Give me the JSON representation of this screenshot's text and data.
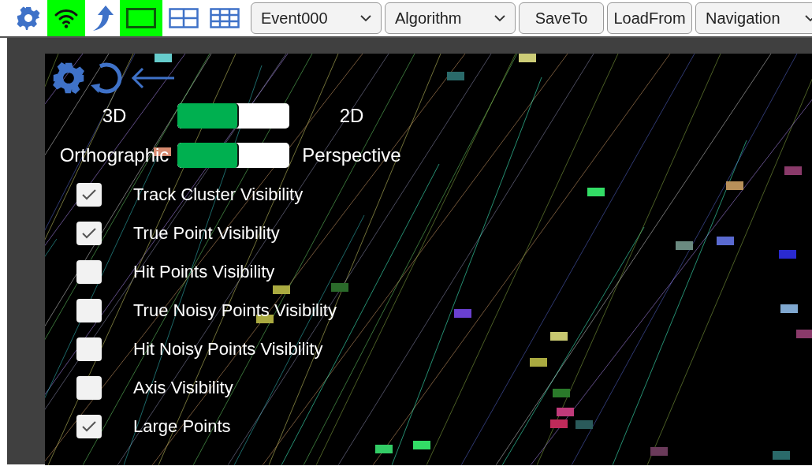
{
  "toolbar": {
    "icons": [
      {
        "kind": "gear",
        "on": false
      },
      {
        "kind": "wifi",
        "on": true
      },
      {
        "kind": "arrow",
        "on": false
      },
      {
        "kind": "single",
        "on": true
      },
      {
        "kind": "grid2",
        "on": false
      },
      {
        "kind": "grid3",
        "on": false
      }
    ],
    "controls": [
      {
        "kind": "dropdown",
        "label": "Event000"
      },
      {
        "kind": "dropdown",
        "label": "Algorithm"
      },
      {
        "kind": "button",
        "label": "SaveTo"
      },
      {
        "kind": "button",
        "label": "LoadFrom"
      },
      {
        "kind": "dropdown",
        "label": "Navigation"
      }
    ]
  },
  "panel": {
    "toggles": [
      {
        "left": "3D",
        "right": "2D",
        "level": 0.55
      },
      {
        "left": "Orthographic",
        "right": "Perspective",
        "level": 0.55
      }
    ],
    "checkboxes": [
      {
        "label": "Track Cluster Visibility",
        "checked": true
      },
      {
        "label": "True Point Visibility",
        "checked": true
      },
      {
        "label": "Hit Points Visibility",
        "checked": false
      },
      {
        "label": "True Noisy Points Visibility",
        "checked": false
      },
      {
        "label": "Hit Noisy Points Visibility",
        "checked": false
      },
      {
        "label": "Axis Visibility",
        "checked": false
      },
      {
        "label": "Large Points",
        "checked": true
      }
    ]
  }
}
